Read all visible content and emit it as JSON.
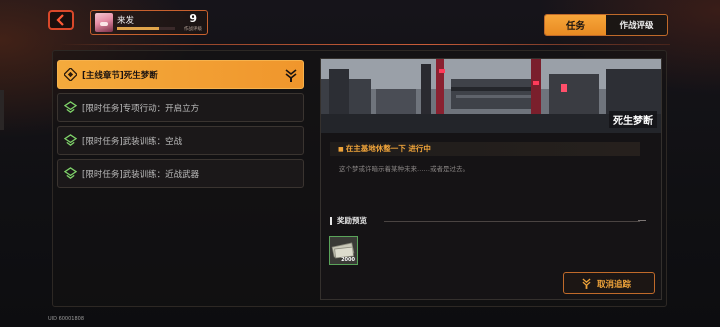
{
  "player": {
    "name": "来发",
    "level": "9",
    "level_caption": "作战评级",
    "exp_progress": 0.72
  },
  "tabs": [
    {
      "label": "任务",
      "active": true
    },
    {
      "label": "作战评级",
      "active": false
    }
  ],
  "tasks": [
    {
      "label": "[主线章节]死生梦断",
      "active": true
    },
    {
      "label": "[限时任务]专项行动：开启立方",
      "active": false
    },
    {
      "label": "[限时任务]武装训练：空战",
      "active": false
    },
    {
      "label": "[限时任务]武装训练：近战武器",
      "active": false
    }
  ],
  "detail": {
    "banner_title": "死生梦断",
    "objective": "在主基地休整一下  进行中",
    "description": "这个梦或许暗示着某种未来……或者是过去。",
    "rewards_label": "奖励预览",
    "rewards": [
      {
        "icon": "cash-icon",
        "count": "2000"
      }
    ],
    "cancel_label": "取消追踪"
  },
  "uid": "UID 60001808",
  "colors": {
    "accent_orange": "#f0a43a",
    "back_red": "#d9482a",
    "reward_border": "#5aa45a"
  }
}
